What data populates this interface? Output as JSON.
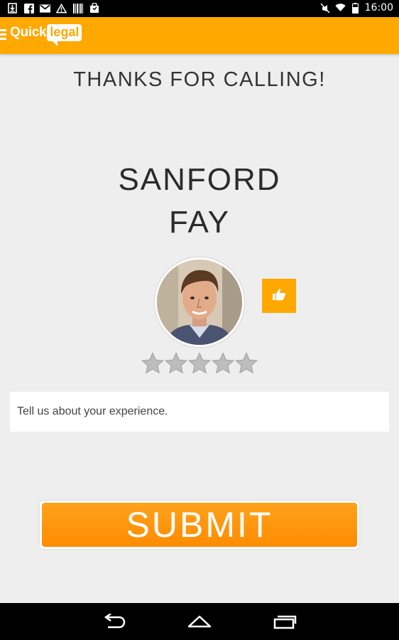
{
  "status_bar": {
    "time": "16:00",
    "icons": [
      "download-icon",
      "facebook-icon",
      "gmail-icon",
      "warning-icon",
      "barcode-icon",
      "shopping-bag-icon",
      "mute-icon",
      "wifi-icon",
      "battery-icon"
    ]
  },
  "app_bar": {
    "logo_quick": "Quick",
    "logo_legal": "legal",
    "menu_icon": "menu-icon"
  },
  "main": {
    "heading": "THANKS FOR CALLING!",
    "first_name": "SANFORD",
    "last_name": "FAY",
    "avatar_alt": "profile photo",
    "like_icon": "thumbs-up-icon",
    "rating": {
      "value": 0,
      "max": 5
    },
    "feedback_placeholder": "Tell us about your experience.",
    "submit_label": "SUBMIT"
  },
  "nav_bar": {
    "buttons": [
      "back-icon",
      "home-icon",
      "recents-icon"
    ]
  },
  "colors": {
    "accent": "#ffa800",
    "background": "#eeeeee",
    "star": "#bdbdbd"
  }
}
